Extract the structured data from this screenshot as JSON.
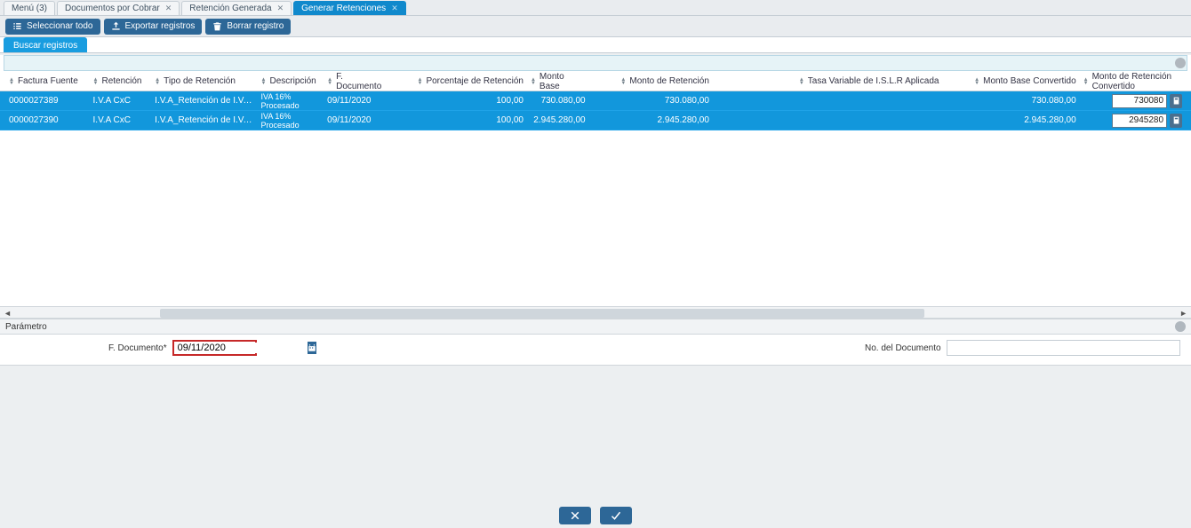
{
  "tabs": [
    {
      "label": "Menú (3)",
      "closeable": false,
      "active": false
    },
    {
      "label": "Documentos por Cobrar",
      "closeable": true,
      "active": false
    },
    {
      "label": "Retención Generada",
      "closeable": true,
      "active": false
    },
    {
      "label": "Generar Retenciones",
      "closeable": true,
      "active": true
    }
  ],
  "toolbar": {
    "select_all": "Seleccionar todo",
    "export": "Exportar registros",
    "delete": "Borrar registro"
  },
  "subtab": {
    "search": "Buscar registros"
  },
  "grid": {
    "columns": [
      "Factura Fuente",
      "Retención",
      "Tipo de Retención",
      "Descripción",
      "F. Documento",
      "Porcentaje de Retención",
      "Monto Base",
      "Monto de Retención",
      "Tasa Variable de I.S.L.R Aplicada",
      "Monto Base Convertido",
      "Monto de Retención Convertido"
    ],
    "rows": [
      {
        "factura": "0000027389",
        "retencion": "I.V.A CxC",
        "tipo": "I.V.A_Retención de I.V.A.",
        "descripcion_l1": "IVA 16%",
        "descripcion_l2": "Procesado",
        "fdoc": "09/11/2020",
        "porcentaje": "100,00",
        "monto_base": "730.080,00",
        "monto_ret": "730.080,00",
        "tasa_var": "",
        "base_conv": "730.080,00",
        "ret_conv_edit": "730080"
      },
      {
        "factura": "0000027390",
        "retencion": "I.V.A CxC",
        "tipo": "I.V.A_Retención de I.V.A.",
        "descripcion_l1": "IVA 16%",
        "descripcion_l2": "Procesado",
        "fdoc": "09/11/2020",
        "porcentaje": "100,00",
        "monto_base": "2.945.280,00",
        "monto_ret": "2.945.280,00",
        "tasa_var": "",
        "base_conv": "2.945.280,00",
        "ret_conv_edit": "2945280"
      }
    ]
  },
  "param": {
    "header": "Parámetro",
    "fdoc_label": "F. Documento*",
    "fdoc_value": "09/11/2020",
    "docno_label": "No. del Documento",
    "docno_value": ""
  }
}
